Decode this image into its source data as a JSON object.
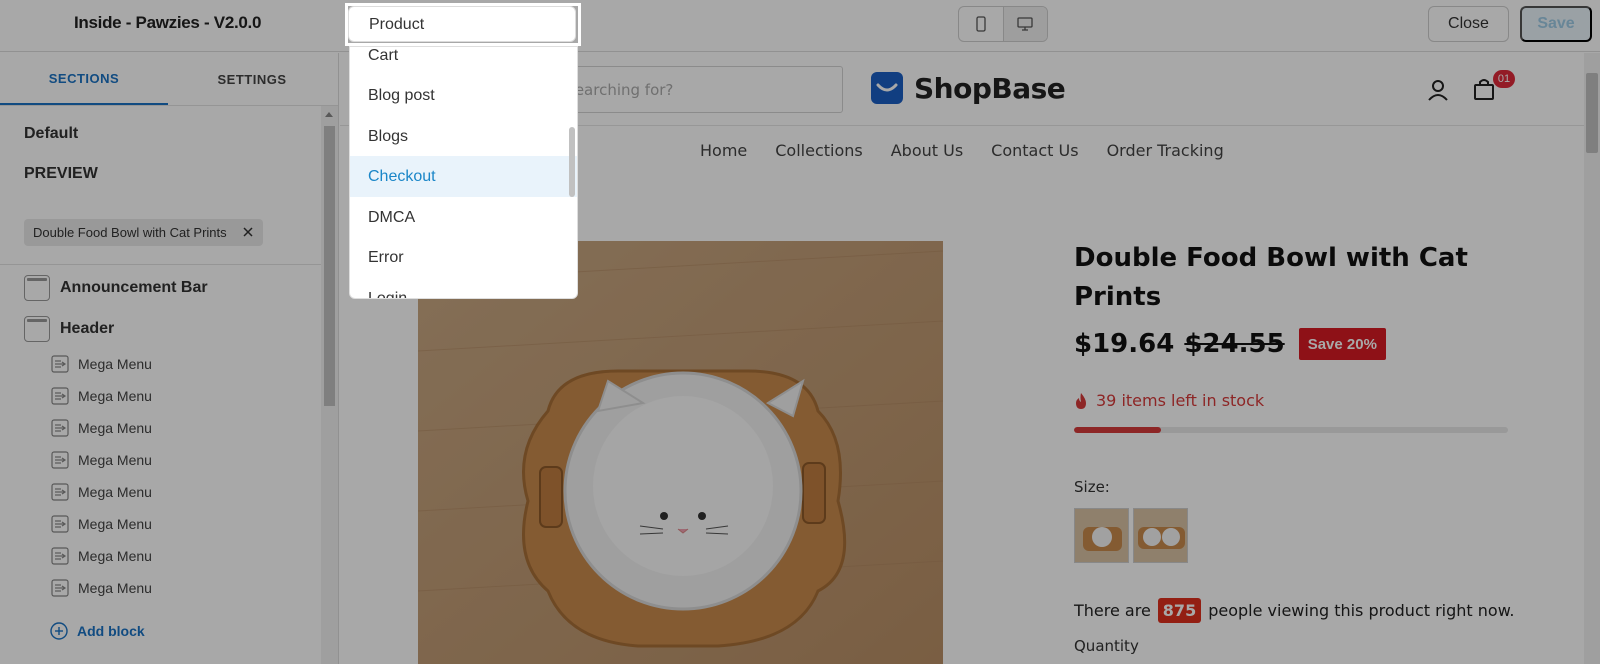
{
  "app": {
    "theme_title": "Inside - Pawzies - V2.0.0",
    "close_label": "Close",
    "save_label": "Save"
  },
  "page_select": {
    "selected": "Product",
    "options": [
      "Cart",
      "Blog post",
      "Blogs",
      "Checkout",
      "DMCA",
      "Error",
      "Login"
    ],
    "highlighted": "Checkout"
  },
  "sidebar": {
    "tabs": [
      "SECTIONS",
      "SETTINGS"
    ],
    "active_tab": "SECTIONS",
    "default_label": "Default",
    "preview_label": "PREVIEW",
    "preview_product": "Double Food Bowl with Cat Prints",
    "sections": [
      "Announcement Bar",
      "Header"
    ],
    "blocks": [
      "Mega Menu",
      "Mega Menu",
      "Mega Menu",
      "Mega Menu",
      "Mega Menu",
      "Mega Menu",
      "Mega Menu",
      "Mega Menu"
    ],
    "add_block_label": "Add block"
  },
  "store": {
    "search_placeholder": "searching for?",
    "logo_text": "ShopBase",
    "cart_count": "01",
    "nav": [
      "Home",
      "Collections",
      "About Us",
      "Contact Us",
      "Order Tracking"
    ],
    "product": {
      "title": "Double Food Bowl with Cat Prints",
      "price": "$19.64",
      "compare_price": "$24.55",
      "save_badge": "Save 20%",
      "stock_text": "39 items left in stock",
      "stock_fraction": 0.2,
      "size_label": "Size:",
      "viewers_prefix": "There are",
      "viewers_count": "875",
      "viewers_suffix": "people viewing this product right now.",
      "quantity_label": "Quantity"
    }
  },
  "colors": {
    "accent": "#1a73c4",
    "sale": "#d81a24",
    "stock": "#d73a3a"
  }
}
